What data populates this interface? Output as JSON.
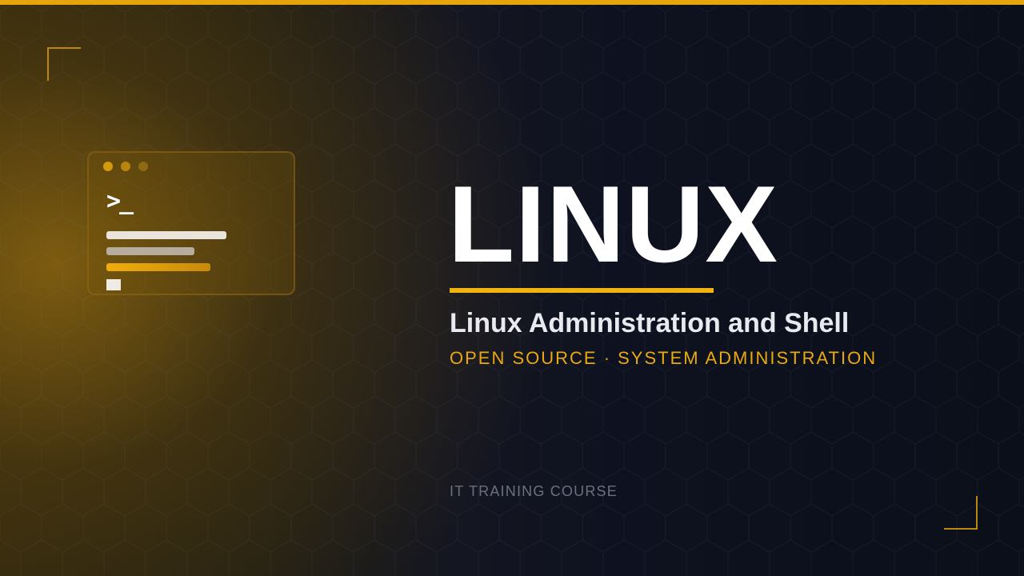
{
  "slide": {
    "title": "LINUX",
    "subtitle": "Linux Administration and Shell",
    "tagline": "OPEN SOURCE · SYSTEM ADMINISTRATION",
    "footer": "IT TRAINING COURSE"
  },
  "terminal": {
    "prompt": ">_",
    "icon": "terminal-window-icon"
  },
  "colors": {
    "accent": "#f2b30f",
    "background": "#0b0f1a",
    "title": "#ffffff",
    "tagline": "#e9a911",
    "footer": "#6b7080"
  }
}
